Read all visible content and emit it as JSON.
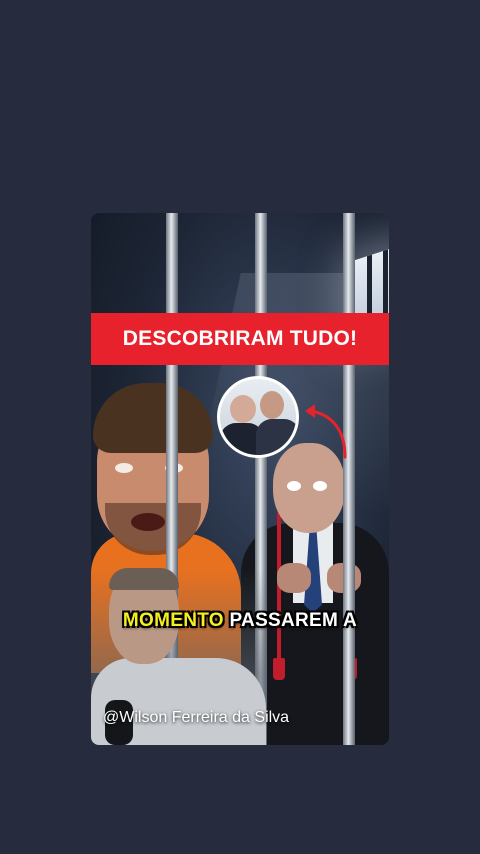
{
  "video": {
    "headline": "DESCOBRIRAM TUDO!",
    "caption_highlight": "MOMENTO",
    "caption_rest": "PASSAREM A",
    "watermark": "@Wilson Ferreira da Silva"
  },
  "colors": {
    "background": "#262b3d",
    "banner": "#e8222c",
    "caption_highlight": "#f6ef1f",
    "jumpsuit": "#e8711f",
    "arrow": "#e8222c"
  },
  "icons": {
    "arrow": "curved-arrow-icon"
  }
}
